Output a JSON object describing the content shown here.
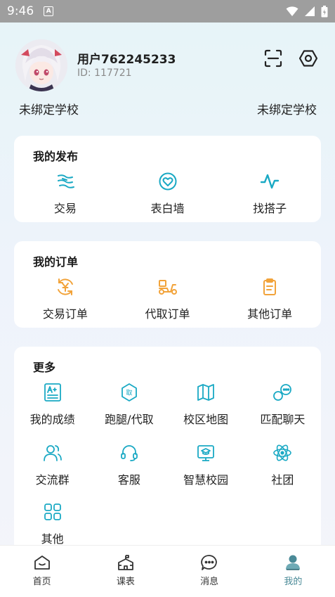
{
  "status": {
    "time": "9:46",
    "badge": "A"
  },
  "profile": {
    "username": "用户762245233",
    "id_text": "ID: 117721",
    "school_left": "未绑定学校",
    "school_right": "未绑定学校"
  },
  "publish": {
    "title": "我的发布",
    "items": [
      {
        "label": "交易",
        "icon": "wave-hand-icon"
      },
      {
        "label": "表白墙",
        "icon": "heart-circle-icon"
      },
      {
        "label": "找搭子",
        "icon": "pulse-icon"
      }
    ]
  },
  "orders": {
    "title": "我的订单",
    "items": [
      {
        "label": "交易订单",
        "icon": "yen-cycle-icon"
      },
      {
        "label": "代取订单",
        "icon": "scooter-icon"
      },
      {
        "label": "其他订单",
        "icon": "clipboard-icon"
      }
    ]
  },
  "more": {
    "title": "更多",
    "items": [
      {
        "label": "我的成绩",
        "icon": "grade-doc-icon"
      },
      {
        "label": "跑腿/代取",
        "icon": "errand-badge-icon"
      },
      {
        "label": "校区地图",
        "icon": "map-icon"
      },
      {
        "label": "匹配聊天",
        "icon": "chat-bubbles-icon"
      },
      {
        "label": "交流群",
        "icon": "group-icon"
      },
      {
        "label": "客服",
        "icon": "headset-icon"
      },
      {
        "label": "智慧校园",
        "icon": "smart-campus-icon"
      },
      {
        "label": "社团",
        "icon": "atom-icon"
      },
      {
        "label": "其他",
        "icon": "grid-icon"
      }
    ]
  },
  "nav": [
    {
      "label": "首页",
      "icon": "home-icon"
    },
    {
      "label": "课表",
      "icon": "school-icon"
    },
    {
      "label": "消息",
      "icon": "message-icon"
    },
    {
      "label": "我的",
      "icon": "person-icon",
      "active": true
    }
  ],
  "colors": {
    "accent_teal": "#1aa9c4",
    "accent_orange": "#f2a33a",
    "nav_active": "#4a8a97"
  }
}
